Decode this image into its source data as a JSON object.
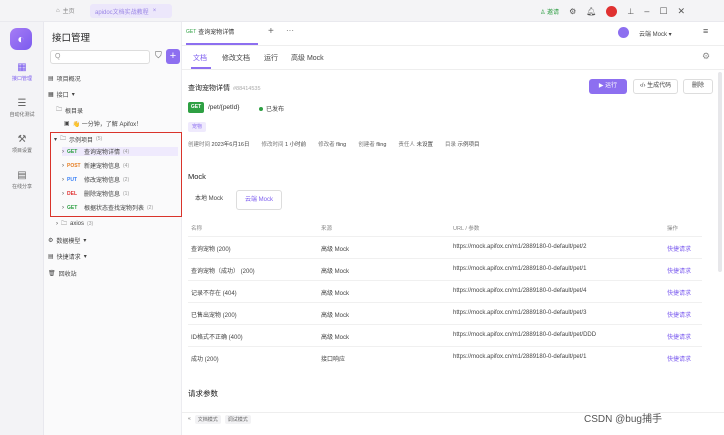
{
  "titlebar": {
    "home_label": "主页",
    "tab_label": "apidoc文档实战教程",
    "invite_label": "邀请",
    "icons": [
      "settings-icon",
      "bell-icon",
      "avatar",
      "pin-icon",
      "minimize-icon",
      "maximize-icon",
      "close-icon"
    ]
  },
  "rail": {
    "items": [
      {
        "label": "接口管理",
        "icon": "api-icon",
        "active": true
      },
      {
        "label": "自动化测试",
        "icon": "test-icon",
        "active": false
      },
      {
        "label": "项目设置",
        "icon": "settings-icon",
        "active": false
      },
      {
        "label": "在线分享",
        "icon": "share-icon",
        "active": false
      }
    ]
  },
  "sidebar": {
    "title": "接口管理",
    "search_placeholder": "Q",
    "overview": "项目概况",
    "interfaces": "接口",
    "root_dir": "根目录",
    "intro_doc": "👋 一分钟，了解 Apifox！",
    "folder_example": "示例项目",
    "folder_example_count": "(5)",
    "endpoints": [
      {
        "method": "GET",
        "name": "查询宠物详情",
        "count": "(4)"
      },
      {
        "method": "POST",
        "name": "新建宠物信息",
        "count": "(4)"
      },
      {
        "method": "PUT",
        "name": "修改宠物信息",
        "count": "(2)"
      },
      {
        "method": "DEL",
        "name": "删除宠物信息",
        "count": "(1)"
      },
      {
        "method": "GET",
        "name": "根据状态查找宠物列表",
        "count": "(2)"
      }
    ],
    "folder_axios": "axios",
    "folder_axios_count": "(3)",
    "data_models": "数据模型",
    "quick_requests": "快捷请求",
    "recycle_bin": "回收站"
  },
  "main": {
    "doc_tab": {
      "method": "GET",
      "name": "查询宠物详情"
    },
    "env_label": "云端 Mock",
    "subtabs": [
      "文档",
      "修改文档",
      "运行",
      "高级 Mock"
    ],
    "api_title": "查询宠物详情",
    "api_id": "#88414535",
    "buttons": {
      "run": "运行",
      "gen_code": "生成代码",
      "delete": "删除"
    },
    "method": "GET",
    "path": "/pet/{petId}",
    "status": "已发布",
    "tag": "宠物",
    "meta": [
      {
        "k": "创建时间",
        "v": "2023年6月16日"
      },
      {
        "k": "修改时间",
        "v": "1 小时前"
      },
      {
        "k": "修改者",
        "v": "fling"
      },
      {
        "k": "创建者",
        "v": "fling"
      },
      {
        "k": "责任人",
        "v": "未设置"
      },
      {
        "k": "目录",
        "v": "示例项目"
      }
    ],
    "mock": {
      "title": "Mock",
      "tabs": [
        "本地 Mock",
        "云端 Mock"
      ],
      "headers": [
        "名称",
        "来源",
        "URL / 参数",
        "操作"
      ],
      "rows": [
        {
          "name": "查询宠物 (200)",
          "source": "高级 Mock",
          "url": "https://mock.apifox.cn/m1/2889180-0-default/pet/2",
          "action": "快捷请求"
        },
        {
          "name": "查询宠物（成功） (200)",
          "source": "高级 Mock",
          "url": "https://mock.apifox.cn/m1/2889180-0-default/pet/1",
          "action": "快捷请求"
        },
        {
          "name": "记录不存在 (404)",
          "source": "高级 Mock",
          "url": "https://mock.apifox.cn/m1/2889180-0-default/pet/4",
          "action": "快捷请求"
        },
        {
          "name": "已售出宠物 (200)",
          "source": "高级 Mock",
          "url": "https://mock.apifox.cn/m1/2889180-0-default/pet/3",
          "action": "快捷请求"
        },
        {
          "name": "ID格式不正确 (400)",
          "source": "高级 Mock",
          "url": "https://mock.apifox.cn/m1/2889180-0-default/pet/DDD",
          "action": "快捷请求"
        },
        {
          "name": "成功 (200)",
          "source": "接口响应",
          "url": "https://mock.apifox.cn/m1/2889180-0-default/pet/1",
          "action": "快捷请求"
        }
      ]
    },
    "request_params": "请求参数",
    "bottom": {
      "doc_mode": "文档模式",
      "debug_mode": "调试模式"
    }
  },
  "watermark": "CSDN @bug捕手"
}
